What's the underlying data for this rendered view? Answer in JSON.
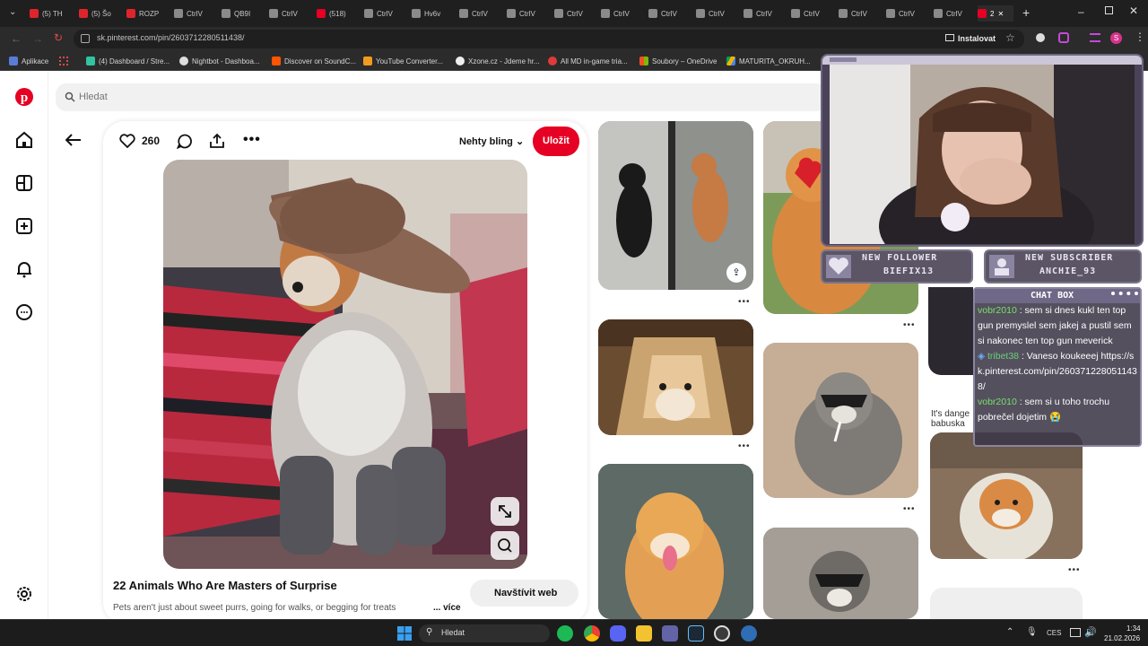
{
  "browser": {
    "tabs": [
      "(5) TH",
      "(5) Šo",
      "ROZP",
      "CtrlV",
      "QB9I",
      "CtrlV",
      "(518)",
      "CtrlV",
      "Hv6v",
      "CtrlV",
      "CtrlV",
      "CtrlV",
      "CtrlV",
      "CtrlV",
      "CtrlV",
      "CtrlV",
      "CtrlV",
      "CtrlV",
      "CtrlV",
      "CtrlV",
      "2"
    ],
    "url": "sk.pinterest.com/pin/2603712280511438/",
    "install_label": "Instalovat",
    "bookmarks": [
      "Aplikace",
      "(4) Dashboard / Stre...",
      "Nightbot - Dashboa...",
      "Discover on SoundC...",
      "YouTube Converter...",
      "Xzone.cz - Jdeme hr...",
      "All MD in-game tria...",
      "Soubory – OneDrive",
      "MATURITA_OKRUH..."
    ]
  },
  "pinterest": {
    "search_placeholder": "Hledat",
    "like_count": "260",
    "board_name": "Nehty bling",
    "save_label": "Uložit",
    "pin_title": "22 Animals Who Are Masters of Surprise",
    "pin_description": "Pets aren't just about sweet purrs, going for walks, or begging for treats",
    "more_label": "... více",
    "visit_label": "Navštívit web",
    "caption_partial": "It's dange\nbabuska",
    "colors": {
      "brand": "#e60023"
    }
  },
  "overlay": {
    "follower_title": "NEW FOLLOWER",
    "follower_name": "BIEFIX13",
    "subscriber_title": "NEW SUBSCRIBER",
    "subscriber_name": "ANCHIE_93",
    "chat_title": "CHAT BOX",
    "chat": [
      {
        "user": "vobr2010",
        "text": " : sem si dnes kukl ten top gun premyslel sem jakej a pustil sem si nakonec ten top gun meverick"
      },
      {
        "user": "tribet38",
        "text": " : Vaneso koukeeej https://sk.pinterest.com/pin/2603712280511438/"
      },
      {
        "user": "vobr2010",
        "text": " : sem si u toho trochu pobrečel dojetim 😭"
      }
    ]
  },
  "taskbar": {
    "search_label": "Hledat",
    "language": "CES",
    "time": "1:34",
    "date": "21.02.2026"
  }
}
